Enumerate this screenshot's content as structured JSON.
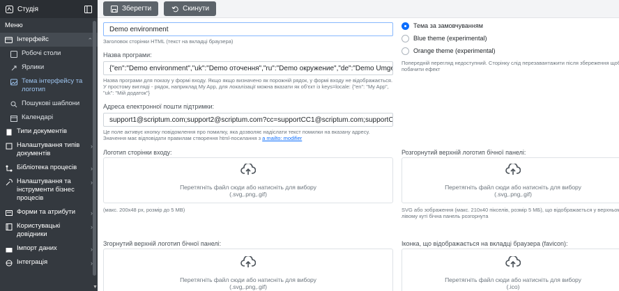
{
  "sidebar": {
    "studio_label": "Студія",
    "menu_label": "Меню",
    "interface_group": "Інтерфейс",
    "sub_items": [
      "Робочі столи",
      "Ярлики",
      "Тема інтерфейсу та логотип",
      "Пошукові шаблони",
      "Календарі"
    ],
    "items": [
      "Типи документів",
      "Налаштування типів документів",
      "Бібліотека процесів",
      "Налаштування та інструменти бізнес процесів",
      "Форми та атрибути",
      "Користувацькі довідники",
      "Імпорт даних",
      "Інтеграція"
    ]
  },
  "toolbar": {
    "save_label": "Зберегти",
    "reset_label": "Скинути"
  },
  "form": {
    "page_title_value": "Demo environment",
    "page_title_hint": "Заголовок сторінки HTML (текст на вкладці браузера)",
    "app_name_label": "Назва програми:",
    "app_name_value": "{\"en\":\"Demo environment\",\"uk\":\"Demo оточення\",\"ru\":\"Demo окружение\",\"de\":\"Demo Umgebung",
    "app_name_hint": "Назва програми для показу у формі входу. Якщо якщо визначено як порожній рядок, у формі входу не відображається. У простому вигляді - рядок, наприклад My App, для локалізації можна вказати як об'єкт із keys=locale: {\"en\": \"My App\", \"uk\": \"Мій додаток\"}",
    "email_label": "Адреса електронної пошти підтримки:",
    "email_value": "support1@scriptum.com;support2@scriptum.com?cc=supportCC1@scriptum.com;supportCC2@",
    "email_hint_1": "Це поле активує кнопку повідомлення про помилку, яка дозволяє надіслати текст помилки на вказану адресу.",
    "email_hint_2": "Значення має відповідати правилам створення html-посилання з",
    "email_hint_link": "а mailto: modifier",
    "login_logo_label": "Логотип сторінки входу:",
    "login_logo_hint": "(макс. 200x48 px, розмір до 5 МВ)",
    "dropzone_text": "Перетягніть файл сюди або натисніть для вибору",
    "formats_svg_png_gif": "(.svg,.png,.gif)",
    "formats_ico": "(.ico)",
    "collapsed_logo_label": "Згорнутий верхній логотип бічної панелі:"
  },
  "right": {
    "theme_options": [
      "Тема за замовчуванням",
      "Blue theme (experimental)",
      "Orange theme (experimental)"
    ],
    "selected_theme": 0,
    "preview_hint": "Попередній перегляд недоступний. Сторінку слід перезавантажити після збереження щоб побачити ефект",
    "expanded_logo_label": "Розгорнутий верхній логотип бічної панелі:",
    "expanded_logo_hint": "SVG або зображення (макс. 210x40 пікселів, розмір 5 МБ), що відображається у верхньому лівому куті бічна панель розгорнута",
    "favicon_label": "Іконка, що відображається на вкладці браузера (favicon):"
  },
  "colors": {
    "sidebar_bg": "#34393f",
    "button_bg": "#5c636a",
    "accent": "#0d6efd"
  }
}
